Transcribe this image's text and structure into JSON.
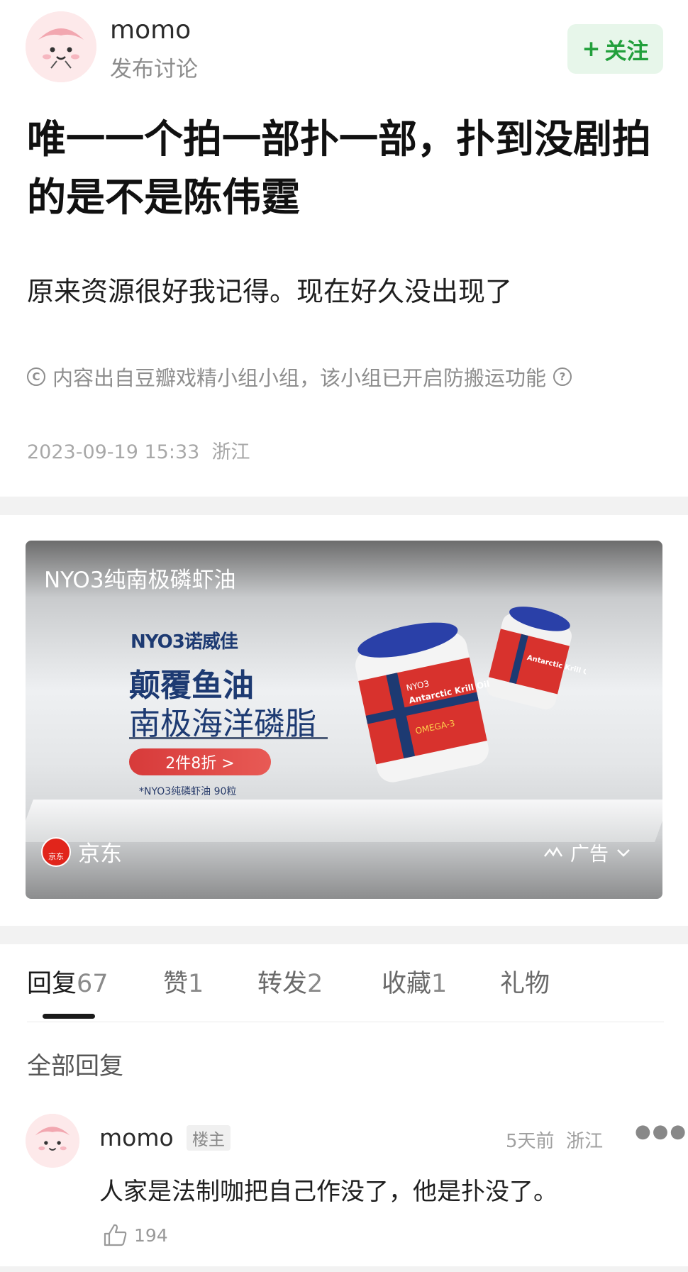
{
  "post": {
    "author": "momo",
    "subtitle": "发布讨论",
    "follow_label": "关注",
    "title": "唯一一个拍一部扑一部，扑到没剧拍的是不是陈伟霆",
    "body": "原来资源很好我记得。现在好久没出现了",
    "copyright_text": "内容出自豆瓣戏精小组小组，该小组已开启防搬运功能",
    "date": "2023-09-19 15:33",
    "location": "浙江"
  },
  "ad": {
    "title": "NYO3纯南极磷虾油",
    "brand": "NYO3诺威佳",
    "headline1": "颠覆鱼油",
    "headline2": "南极海洋磷脂",
    "promo": "2件8折 >",
    "note": "*NYO3纯磷虾油 90粒",
    "jar_text": "Antarctic Krill Oil",
    "jar_sub": "OMEGA-3",
    "jar_brand": "NYO3",
    "source_logo": "京东",
    "source": "京东",
    "tag": "广告"
  },
  "tabs": [
    {
      "label": "回复",
      "count": "67"
    },
    {
      "label": "赞",
      "count": "1"
    },
    {
      "label": "转发",
      "count": "2"
    },
    {
      "label": "收藏",
      "count": "1"
    },
    {
      "label": "礼物",
      "count": ""
    }
  ],
  "replies_header": "全部回复",
  "comment": {
    "author": "momo",
    "badge": "楼主",
    "time": "5天前",
    "location": "浙江",
    "text": "人家是法制咖把自己作没了，他是扑没了。",
    "likes": "194"
  },
  "colors": {
    "follow_green": "#22a03c",
    "follow_bg": "#e7f6ea",
    "ad_navy": "#1d3a72",
    "ad_red": "#d73a3a"
  }
}
